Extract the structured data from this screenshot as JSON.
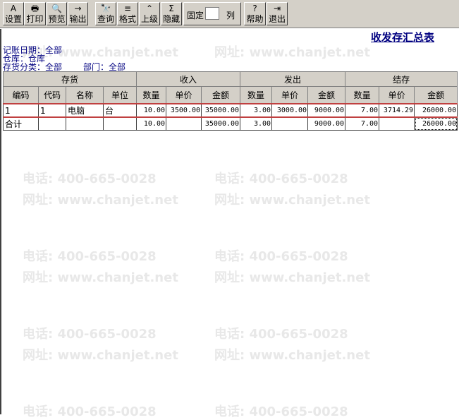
{
  "toolbar": {
    "buttons": [
      {
        "label": "设置",
        "icon": "A"
      },
      {
        "label": "打印",
        "icon": "🖶"
      },
      {
        "label": "预览",
        "icon": "🔍"
      },
      {
        "label": "输出",
        "icon": "→"
      },
      {
        "label": "查询",
        "icon": "🔭"
      },
      {
        "label": "格式",
        "icon": "≡"
      },
      {
        "label": "上级",
        "icon": "⌃"
      },
      {
        "label": "隐藏",
        "icon": "Σ"
      },
      {
        "label": "帮助",
        "icon": "?"
      },
      {
        "label": "退出",
        "icon": "⇥"
      }
    ],
    "fix_label": "固定",
    "fix_value": "",
    "col_label": "列"
  },
  "report": {
    "title": "收发存汇总表",
    "date": "记账日期：全部",
    "warehouse": "仓库：仓库",
    "category": "存货分类：全部",
    "dept": "部门：全部"
  },
  "table": {
    "groups": [
      "存货",
      "收入",
      "发出",
      "结存"
    ],
    "columns": [
      "编码",
      "代码",
      "名称",
      "单位",
      "数量",
      "单价",
      "金额",
      "数量",
      "单价",
      "金额",
      "数量",
      "单价",
      "金额"
    ],
    "rows": [
      [
        "1",
        "1",
        "电脑",
        "台",
        "10.00",
        "3500.00",
        "35000.00",
        "3.00",
        "3000.00",
        "9000.00",
        "7.00",
        "3714.29",
        "26000.00"
      ],
      [
        "合计",
        "",
        "",
        "",
        "10.00",
        "",
        "35000.00",
        "3.00",
        "",
        "9000.00",
        "7.00",
        "",
        "26000.00"
      ]
    ]
  },
  "watermark": {
    "phone": "电话: 400-665-0028",
    "site": "网址: www.chanjet.net"
  }
}
